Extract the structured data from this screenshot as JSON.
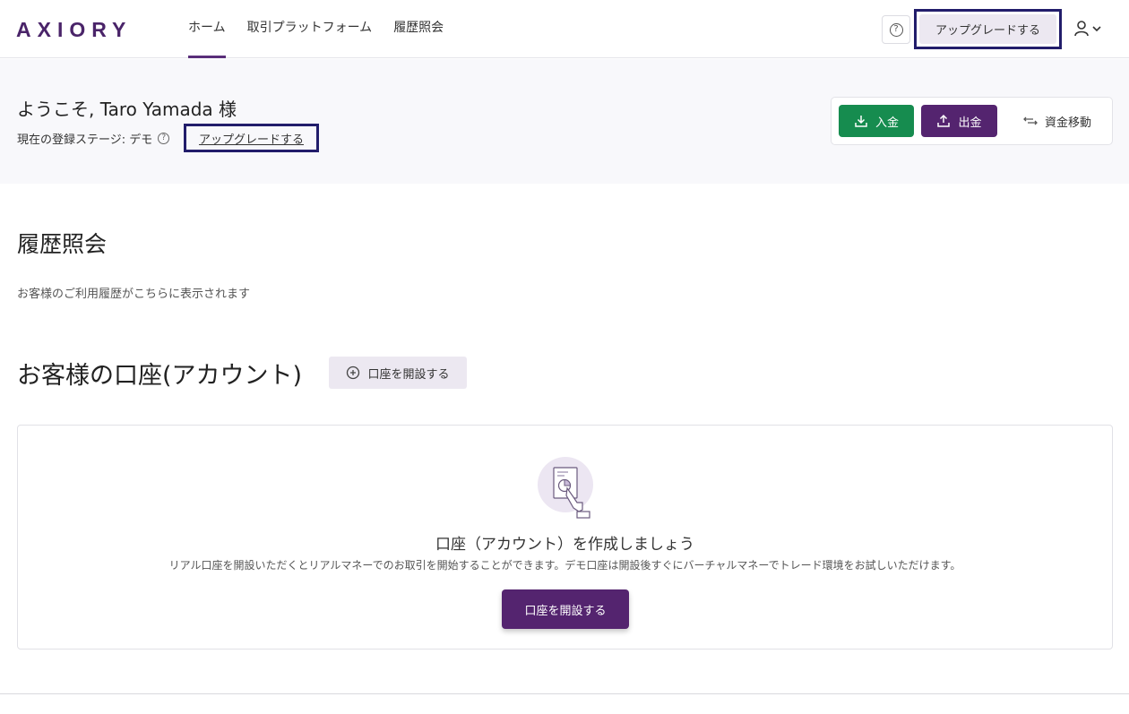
{
  "header": {
    "logo": "AXIORY",
    "nav": [
      "ホーム",
      "取引プラットフォーム",
      "履歴照会"
    ],
    "help_symbol": "?",
    "upgrade_label": "アップグレードする"
  },
  "welcome": {
    "title": "ようこそ, Taro Yamada 様",
    "stage_label": "現在の登録ステージ: デモ",
    "help_symbol": "?",
    "upgrade_link": "アップグレードする"
  },
  "funds": {
    "deposit_label": "入金",
    "withdraw_label": "出金",
    "transfer_label": "資金移動"
  },
  "history": {
    "title": "履歴照会",
    "description": "お客様のご利用履歴がこちらに表示されます"
  },
  "accounts": {
    "title": "お客様の口座(アカウント)",
    "open_small_label": "口座を開設する",
    "empty_title": "口座（アカウント）を作成しましょう",
    "empty_description": "リアル口座を開設いただくとリアルマネーでのお取引を開始することができます。デモ口座は開設後すぐにバーチャルマネーでトレード環境をお試しいただけます。",
    "open_main_label": "口座を開設する"
  },
  "icons": {
    "help": "question-circle-icon",
    "user": "user-icon",
    "chevron": "chevron-down-icon",
    "deposit": "download-tray-icon",
    "withdraw": "upload-tray-icon",
    "transfer": "arrows-transfer-icon",
    "add": "plus-circle-icon",
    "illustration": "document-chart-hand-icon"
  },
  "colors": {
    "brand": "#4a2469",
    "primary": "#54246f",
    "deposit_green": "#168c4f",
    "light_purple": "#ece8f1",
    "highlight_border": "#221d6b"
  }
}
